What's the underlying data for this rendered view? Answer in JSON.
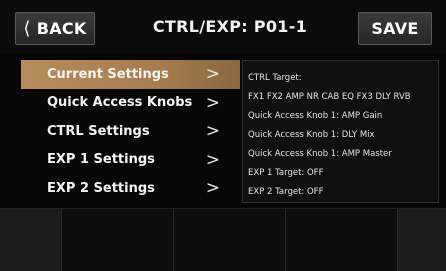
{
  "header": {
    "back_label": "BACK",
    "title": "CTRL/EXP: P01-1",
    "save_label": "SAVE"
  },
  "menu": {
    "items": [
      {
        "label": "Current Settings",
        "active": true
      },
      {
        "label": "Quick Access Knobs",
        "active": false
      },
      {
        "label": "CTRL Settings",
        "active": false
      },
      {
        "label": "EXP 1 Settings",
        "active": false
      },
      {
        "label": "EXP 2 Settings",
        "active": false
      }
    ]
  },
  "info": {
    "lines": [
      "CTRL Target:",
      "FX1 FX2 AMP NR CAB EQ FX3 DLY RVB",
      "Quick Access Knob 1: AMP Gain",
      "Quick Access Knob 1: DLY Mix",
      "Quick Access Knob 1: AMP Master",
      "EXP 1 Target: OFF",
      "EXP 2 Target: OFF"
    ]
  },
  "colors": {
    "active_item": "#b88d5d",
    "background": "#070707",
    "button": "#303030"
  }
}
